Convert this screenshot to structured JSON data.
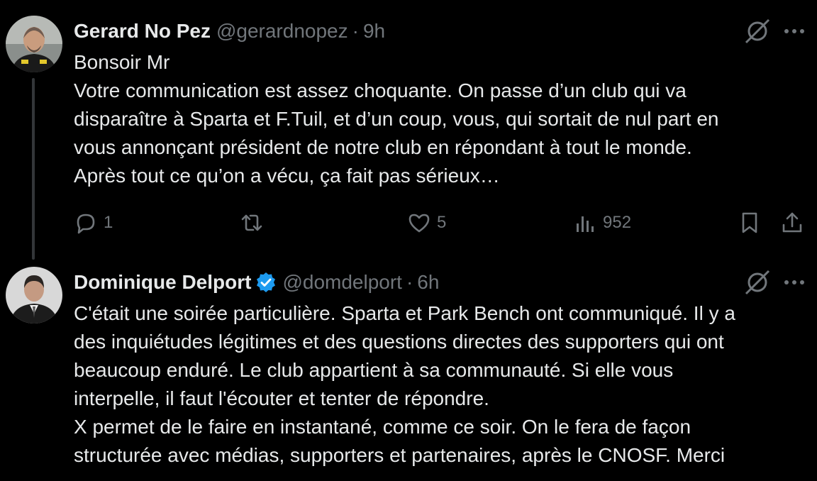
{
  "tweets": [
    {
      "author": {
        "name": "Gerard No Pez",
        "handle": "@gerardnopez",
        "verified": false
      },
      "separator": "·",
      "time": "9h",
      "lines": [
        "Bonsoir Mr",
        "Votre communication est assez choquante. On passe d’un club qui va",
        "disparaître à Sparta et F.Tuil, et d’un coup, vous, qui sortait de nul part en",
        "vous annonçant président de notre club en répondant à tout le monde.",
        "Après tout ce qu’on a vécu, ça fait pas sérieux…"
      ],
      "stats": {
        "replies": "1",
        "reposts": "",
        "likes": "5",
        "views": "952"
      }
    },
    {
      "author": {
        "name": "Dominique Delport",
        "handle": "@domdelport",
        "verified": true
      },
      "separator": "·",
      "time": "6h",
      "lines": [
        "C'était une soirée particulière. Sparta et Park Bench ont communiqué. Il y a",
        "des inquiétudes légitimes et des questions directes des supporters qui ont",
        "beaucoup enduré. Le club appartient à sa communauté. Si elle vous",
        "interpelle, il faut l'écouter et tenter de répondre.",
        "X permet de le faire en instantané, comme ce soir. On le fera de façon",
        "structurée avec médias, supporters et partenaires, après le CNOSF. Merci"
      ]
    }
  ],
  "colors": {
    "background": "#000000",
    "text": "#e7e9ea",
    "secondary": "#71767b",
    "verified": "#1d9bf0",
    "thread_line": "#333639"
  },
  "icons": [
    "grok-icon",
    "more-icon",
    "reply-icon",
    "repost-icon",
    "like-icon",
    "views-icon",
    "bookmark-icon",
    "share-icon",
    "verified-badge-icon"
  ]
}
